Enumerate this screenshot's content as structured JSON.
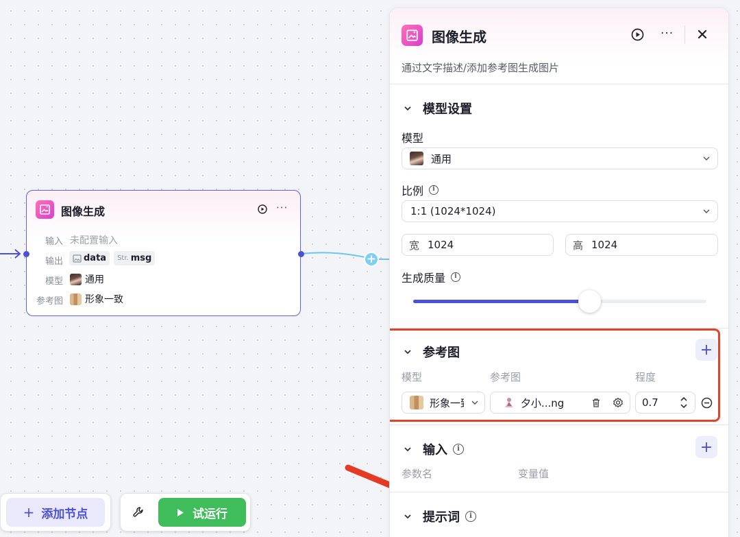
{
  "canvas": {
    "node": {
      "title": "图像生成",
      "more": "···",
      "rows": {
        "input_label": "输入",
        "input_value": "未配置输入",
        "output_label": "输出",
        "output_tag1": "data",
        "output_tag2_prefix": "Str.",
        "output_tag2": "msg",
        "model_label": "模型",
        "model_value": "通用",
        "ref_label": "参考图",
        "ref_value": "形象一致"
      }
    },
    "add_node_label": "添加节点",
    "add_node_icon": "+",
    "run_label": "试运行"
  },
  "panel": {
    "title": "图像生成",
    "more": "···",
    "description": "通过文字描述/添加参考图生成图片",
    "model_section": {
      "title": "模型设置",
      "model_label": "模型",
      "model_value": "通用",
      "ratio_label": "比例",
      "ratio_value": "1:1 (1024*1024)",
      "width_label": "宽",
      "width_value": "1024",
      "height_label": "高",
      "height_value": "1024",
      "quality_label": "生成质量",
      "quality_level": 0.6
    },
    "ref_section": {
      "title": "参考图",
      "col_model": "模型",
      "col_image": "参考图",
      "col_degree": "程度",
      "row_model": "形象一致",
      "row_image": "夕小...ng",
      "row_degree": "0.7"
    },
    "input_section": {
      "title": "输入",
      "col_param": "参数名",
      "col_value": "变量值"
    },
    "prompt_section": {
      "title": "提示词"
    }
  },
  "colors": {
    "accent": "#4b50d9",
    "run_green": "#3fbd5a",
    "highlight_red": "#e0452a",
    "annotation_arrow": "#e53b25",
    "edge_blue": "#6cc6f0"
  }
}
